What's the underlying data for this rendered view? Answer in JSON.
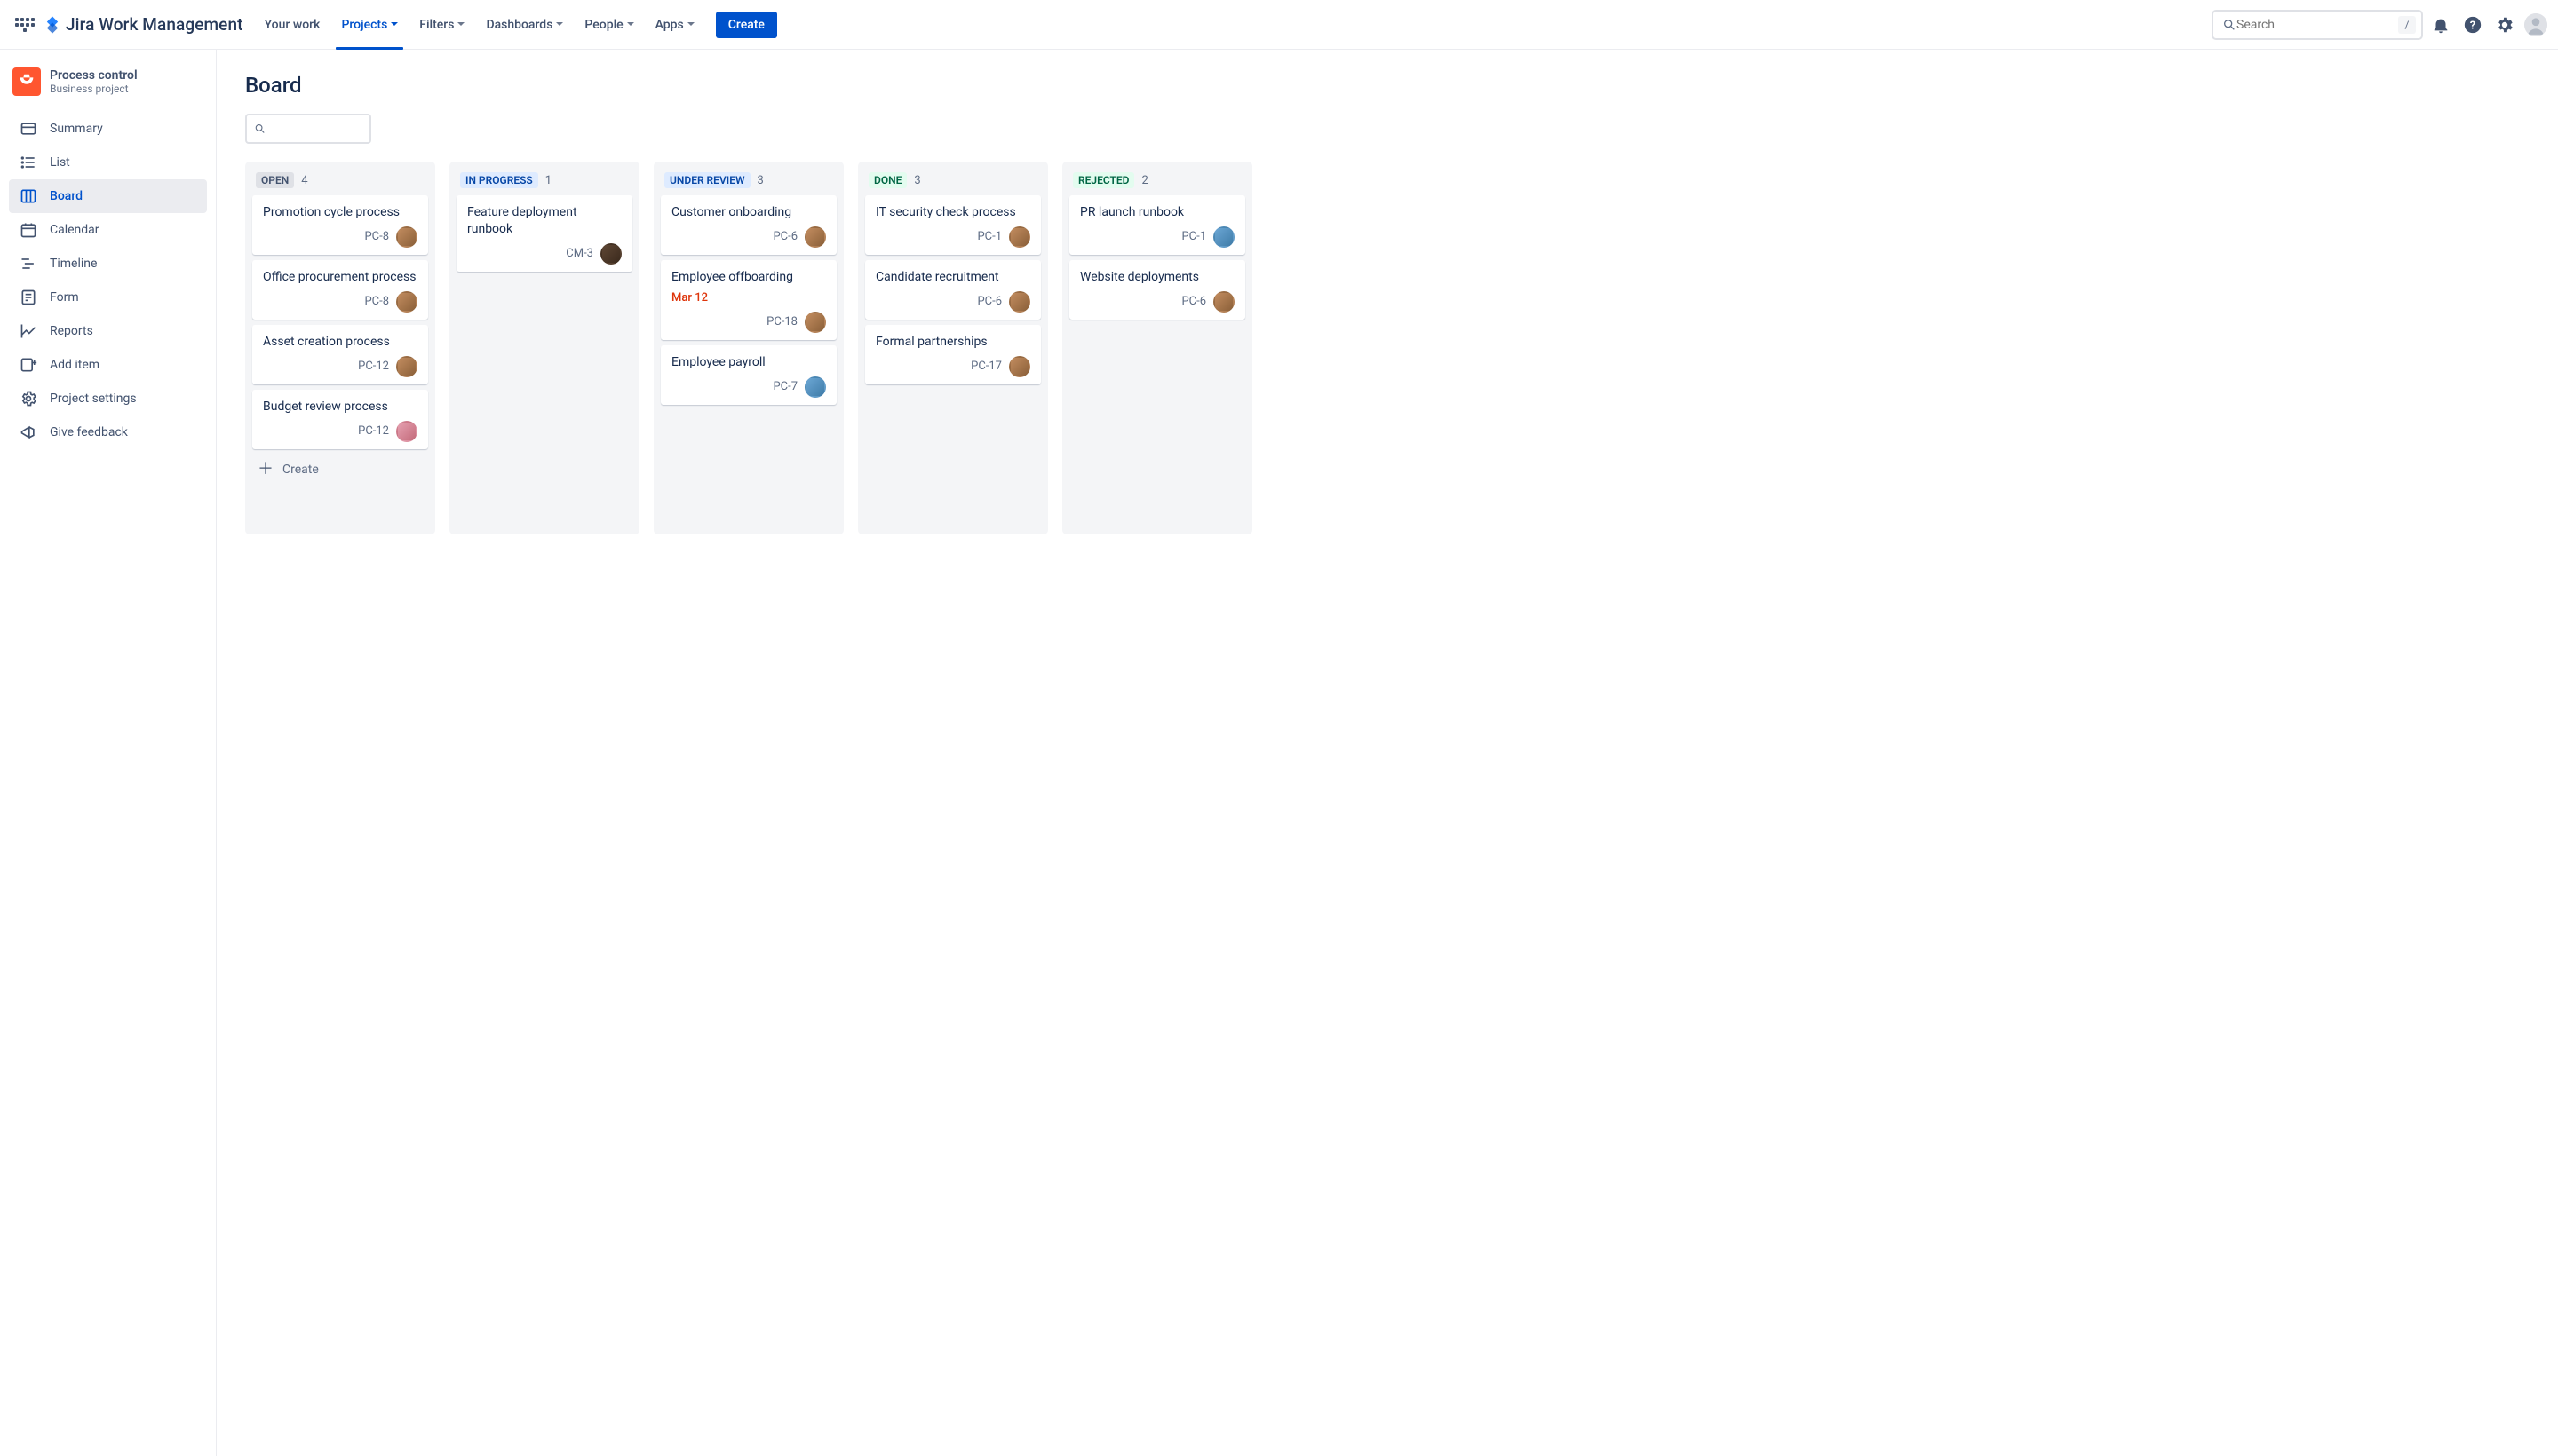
{
  "brand": "Jira Work Management",
  "nav": {
    "yourwork": "Your work",
    "projects": "Projects",
    "filters": "Filters",
    "dashboards": "Dashboards",
    "people": "People",
    "apps": "Apps",
    "create": "Create"
  },
  "search": {
    "placeholder": "Search",
    "kbd": "/"
  },
  "project": {
    "name": "Process control",
    "type": "Business project"
  },
  "sidebar": {
    "summary": "Summary",
    "list": "List",
    "board": "Board",
    "calendar": "Calendar",
    "timeline": "Timeline",
    "form": "Form",
    "reports": "Reports",
    "additem": "Add item",
    "settings": "Project settings",
    "feedback": "Give feedback"
  },
  "page": {
    "title": "Board"
  },
  "columns": {
    "open": {
      "label": "Open",
      "count": "4"
    },
    "progress": {
      "label": "In Progress",
      "count": "1"
    },
    "review": {
      "label": "Under Review",
      "count": "3"
    },
    "done": {
      "label": "Done",
      "count": "3"
    },
    "rejected": {
      "label": "Rejected",
      "count": "2"
    }
  },
  "cards": {
    "open1": {
      "title": "Promotion cycle process",
      "key": "PC-8"
    },
    "open2": {
      "title": "Office procurement process",
      "key": "PC-8"
    },
    "open3": {
      "title": "Asset creation process",
      "key": "PC-12"
    },
    "open4": {
      "title": "Budget review process",
      "key": "PC-12"
    },
    "prog1": {
      "title": "Feature deployment runbook",
      "key": "CM-3"
    },
    "rev1": {
      "title": "Customer onboarding",
      "key": "PC-6"
    },
    "rev2": {
      "title": "Employee offboarding",
      "key": "PC-18",
      "due": "Mar 12"
    },
    "rev3": {
      "title": "Employee payroll",
      "key": "PC-7"
    },
    "done1": {
      "title": "IT security check process",
      "key": "PC-1"
    },
    "done2": {
      "title": "Candidate recruitment",
      "key": "PC-6"
    },
    "done3": {
      "title": "Formal partnerships",
      "key": "PC-17"
    },
    "rej1": {
      "title": "PR launch runbook",
      "key": "PC-1"
    },
    "rej2": {
      "title": "Website deployments",
      "key": "PC-6"
    }
  },
  "createLabel": "Create"
}
